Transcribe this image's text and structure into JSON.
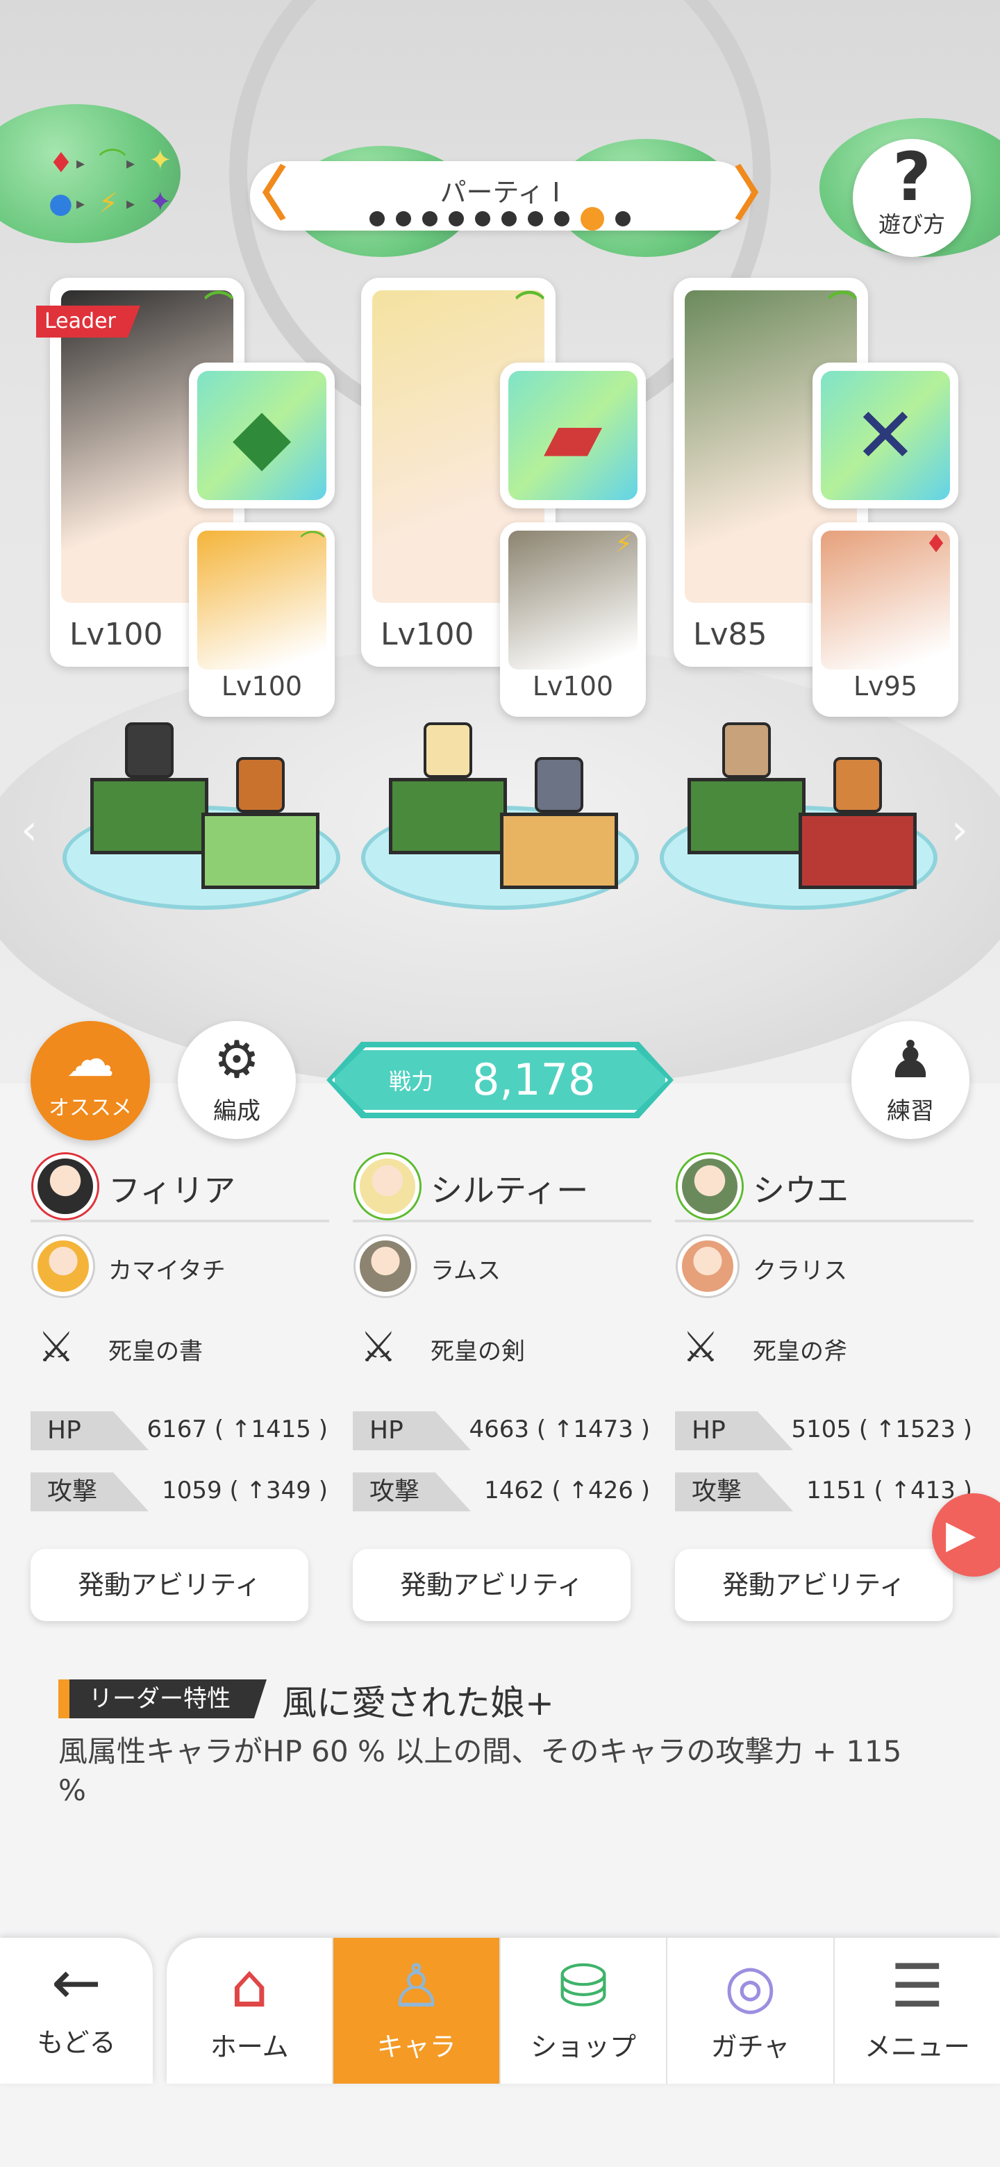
{
  "header": {
    "party_title": "パーティ I",
    "party_arrow_left": "〈",
    "party_arrow_right": "〉",
    "party_pages": 10,
    "party_active_index": 8,
    "help_label": "遊び方",
    "help_icon": "question-icon"
  },
  "element_legend": {
    "fire": "♦",
    "wind": "⌒",
    "light": "✦",
    "water": "●",
    "thunder": "⚡",
    "dark": "✦",
    "arrow": "▸"
  },
  "team": [
    {
      "leader_tag": "Leader",
      "main_level": "Lv100",
      "main_element": "wind",
      "unison_level": "Lv100",
      "unison_element": "wind",
      "weapon_icon": "green-gem-book-icon",
      "main_color": "#2d2d2d",
      "unison_color": "#f4b43a"
    },
    {
      "leader_tag": "",
      "main_level": "Lv100",
      "main_element": "wind",
      "unison_level": "Lv100",
      "unison_element": "thunder",
      "weapon_icon": "red-sword-icon",
      "main_color": "#f4e2a0",
      "unison_color": "#8c8470"
    },
    {
      "leader_tag": "",
      "main_level": "Lv85",
      "main_element": "wind",
      "unison_level": "Lv95",
      "unison_element": "fire",
      "weapon_icon": "dark-axe-icon",
      "main_color": "#6b8a5c",
      "unison_color": "#e6a07a"
    }
  ],
  "actions": {
    "recommend_label": "オススメ",
    "formation_label": "編成",
    "practice_label": "練習",
    "power_label": "戦力",
    "power_value": "8,178"
  },
  "members": [
    {
      "main_name": "フィリア",
      "unison_name": "カマイタチ",
      "weapon_name": "死皇の書",
      "hp_label": "HP",
      "hp_value": "6167 ( ↑1415 )",
      "atk_label": "攻撃",
      "atk_value": "1059 ( ↑349 )",
      "ability_label": "発動アビリティ"
    },
    {
      "main_name": "シルティー",
      "unison_name": "ラムス",
      "weapon_name": "死皇の剣",
      "hp_label": "HP",
      "hp_value": "4663 ( ↑1473 )",
      "atk_label": "攻撃",
      "atk_value": "1462 ( ↑426 )",
      "ability_label": "発動アビリティ"
    },
    {
      "main_name": "シウエ",
      "unison_name": "クラリス",
      "weapon_name": "死皇の斧",
      "hp_label": "HP",
      "hp_value": "5105 ( ↑1523 )",
      "atk_label": "攻撃",
      "atk_value": "1151 ( ↑413 )",
      "ability_label": "発動アビリティ"
    }
  ],
  "leader_trait": {
    "tag": "リーダー特性",
    "name": "風に愛された娘+",
    "description": "風属性キャラがHP 60 % 以上の間、そのキャラの攻撃力 + 115 %"
  },
  "nav": {
    "back_label": "もどる",
    "items": [
      {
        "label": "ホーム",
        "icon": "home-icon"
      },
      {
        "label": "キャラ",
        "icon": "character-icon"
      },
      {
        "label": "ショップ",
        "icon": "shop-icon"
      },
      {
        "label": "ガチャ",
        "icon": "gacha-icon"
      },
      {
        "label": "メニュー",
        "icon": "menu-icon"
      }
    ],
    "active": "キャラ"
  },
  "colors": {
    "accent_orange": "#f49a25",
    "teal": "#37c4b3",
    "wind_green": "#5dbb2f",
    "fire_red": "#e0323a",
    "thunder_yellow": "#f2c12e"
  }
}
